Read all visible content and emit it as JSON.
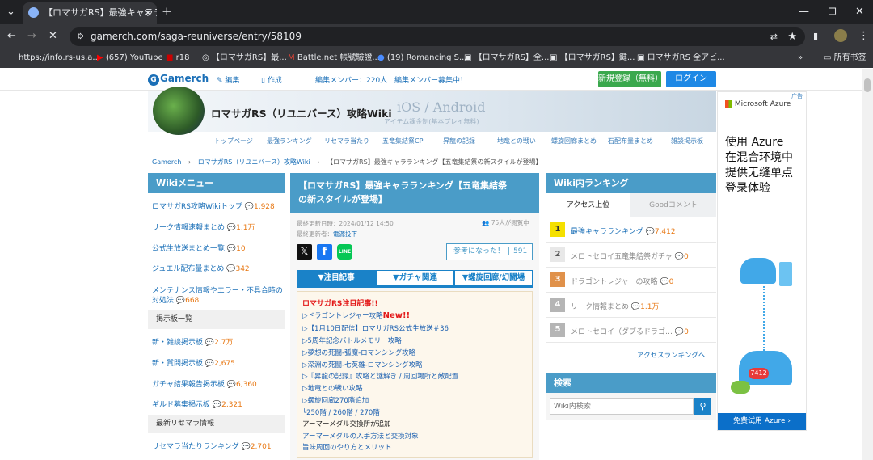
{
  "browser": {
    "tab_title": "【ロマサガRS】最強キャララン",
    "new_tab": "+",
    "url": "gamerch.com/saga-reuniverse/entry/58109",
    "bookmarks": [
      "https://info.rs-us.a...",
      "(657) YouTube",
      "r18",
      "【ロマサガRS】最...",
      "Battle.net 帳號驗證...",
      "(19) Romancing S...",
      "【ロマサガRS】全...",
      "【ロマサガRS】鍵...",
      "ロマサガRS 全アビ..."
    ],
    "all_bookmarks": "所有书签",
    "more": "»"
  },
  "site": {
    "logo": "Gamerch",
    "edit": "編集",
    "create": "作成",
    "members": "編集メンバー：220人",
    "recruit": "編集メンバー募集中！",
    "register": "新規登録（無料）",
    "login": "ログイン",
    "wiki_title": "ロマサガRS（リユニバース）攻略Wiki",
    "banner_sub1": "iOS / Android",
    "banner_sub2": "アイテム課金制(基本プレイ無料)",
    "nav": [
      "トップページ",
      "最強ランキング",
      "リセマラ当たり",
      "五竜集結祭CP",
      "昇龍の記録",
      "地竜との戦い",
      "螺旋回廊まとめ",
      "石配布量まとめ",
      "雑談掲示板"
    ],
    "breadcrumb": [
      "Gamerch",
      "ロマサガRS（リユニバース）攻略Wiki",
      "【ロマサガRS】最強キャラランキング【五竜集結祭の新スタイルが登場】"
    ]
  },
  "left_menu": {
    "title": "Wikiメニュー",
    "items": [
      {
        "label": "ロマサガRS攻略Wikiトップ",
        "count": "1,928"
      },
      {
        "label": "リーク情報速報まとめ",
        "count": "1.1万"
      },
      {
        "label": "公式生放送まとめ一覧",
        "count": "10"
      },
      {
        "label": "ジュエル配布量まとめ",
        "count": "342"
      },
      {
        "label": "メンテナンス情報やエラー・不具合時の",
        "label2": "対処法",
        "count": "668"
      }
    ],
    "sec1": "掲示板一覧",
    "boards": [
      {
        "label": "新・雑談掲示板",
        "count": "2.7万"
      },
      {
        "label": "新・質問掲示板",
        "count": "2,675"
      },
      {
        "label": "ガチャ結果報告掲示板",
        "count": "6,360"
      },
      {
        "label": "ギルド募集掲示板",
        "count": "2,321"
      }
    ],
    "sec2": "最新リセマラ情報",
    "reroll": {
      "label": "リセマラ当たりランキング",
      "count": "2,701"
    }
  },
  "article": {
    "title1": "【ロマサガRS】最強キャラランキング【五竜集結祭",
    "title2": "の新スタイルが登場】",
    "updated": "最終更新日時：2024/01/12 14:50",
    "viewers": "75人が閲覧中",
    "updater_label": "最終更新者：",
    "updater": "電源投下",
    "helpful": "参考になった！",
    "helpful_count": "591",
    "tabs": [
      "▼注目記事",
      "▼ガチャ関連",
      "▼螺旋回廊/幻闘場"
    ],
    "box_title": "ロマサガRS注目記事!!",
    "links": [
      "▷ドラゴントレジャー攻略",
      "▷【1月10日配信】ロマサガRS公式生放送＃36",
      "▷5周年記念バトルメモリー攻略",
      "▷夢想の死闘-弧魔-ロマンシング攻略",
      "▷深淵の死闘-七英雄-ロマンシング攻略",
      "▷『昇龍の記録』攻略と謎解き / 周回場所と敵配置",
      "▷地竜との戦い攻略",
      "▷螺旋回廊270階追加"
    ],
    "new_badge": "New!!",
    "floors": "└250階 / 260階 / 270階",
    "medal": "アーマーメダル交換所が追加",
    "medal_link1": "アーマーメダルの入手方法と交換対象",
    "medal_link2": "旨味周回のやり方とメリット"
  },
  "ranking": {
    "title": "Wiki内ランキング",
    "tab1": "アクセス上位",
    "tab2": "Goodコメント",
    "rows": [
      {
        "n": "1",
        "label": "最強キャラランキング",
        "count": "7,412",
        "color": "#f5e000"
      },
      {
        "n": "2",
        "label": "メロトセロイ五竜集結祭ガチャ",
        "count": "0",
        "color": "#c4c4c4"
      },
      {
        "n": "3",
        "label": "ドラゴントレジャーの攻略",
        "count": "0",
        "color": "#e0914a"
      },
      {
        "n": "4",
        "label": "リーク情報まとめ",
        "count": "1.1万",
        "color": "#b5b5b5"
      },
      {
        "n": "5",
        "label": "メロトセロイ（ダブるドラゴ…",
        "count": "0",
        "color": "#b5b5b5"
      }
    ],
    "more": "アクセスランキングへ",
    "search_title": "検索",
    "search_placeholder": "Wiki内検索"
  },
  "ad": {
    "brand": "Microsoft Azure",
    "line1": "使用 Azure",
    "line2": "在混合环境中",
    "line3": "提供无缝单点",
    "line4": "登录体验",
    "badge": "7412",
    "cta": "免费试用 Azure",
    "ad_mark": "广告"
  }
}
